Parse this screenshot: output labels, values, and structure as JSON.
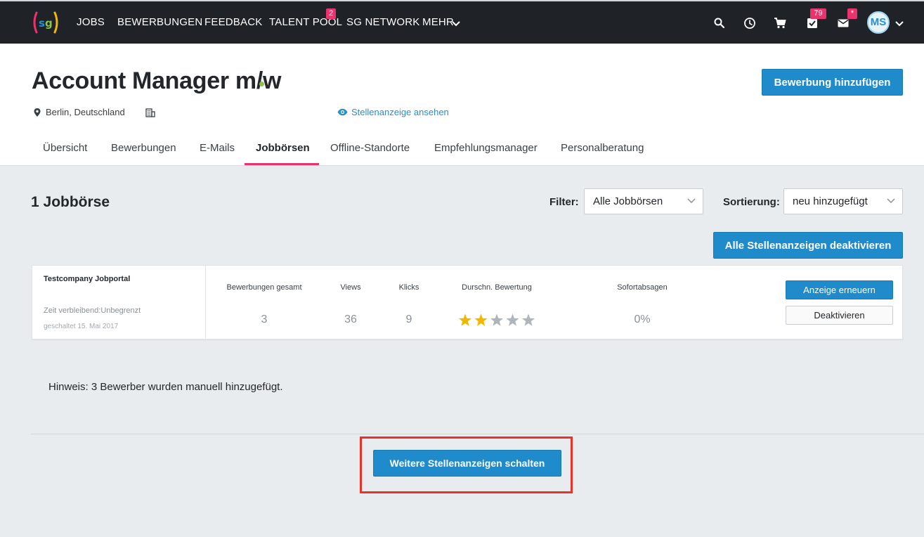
{
  "nav": {
    "items": [
      {
        "label": "JOBS"
      },
      {
        "label": "BEWERBUNGEN"
      },
      {
        "label": "FEEDBACK"
      },
      {
        "label": "TALENT POOL",
        "badge": "2"
      },
      {
        "label": "SG NETWORK"
      },
      {
        "label": "MEHR"
      }
    ],
    "tasks_badge": "79",
    "mail_badge": "*",
    "avatar_initials": "MS"
  },
  "header": {
    "title": "Account Manager m/w",
    "location": "Berlin, Deutschland",
    "view_link": "Stellenanzeige ansehen",
    "add_button": "Bewerbung hinzufügen",
    "tabs": [
      "Übersicht",
      "Bewerbungen",
      "E-Mails",
      "Jobbörsen",
      "Offline-Standorte",
      "Empfehlungsmanager",
      "Personalberatung"
    ],
    "active_tab": "Jobbörsen"
  },
  "main": {
    "count_title": "1 Jobbörse",
    "filter_label": "Filter:",
    "filter_value": "Alle Jobbörsen",
    "sort_label": "Sortierung:",
    "sort_value": "neu hinzugefügt",
    "deactivate_all": "Alle Stellenanzeigen deaktivieren",
    "card": {
      "portal": "Testcompany Jobportal",
      "remaining": "Zeit verbleibend:Unbegrenzt",
      "since": "geschaltet 15. Mai 2017",
      "stats": [
        {
          "header": "Bewerbungen gesamt",
          "value": "3"
        },
        {
          "header": "Views",
          "value": "36"
        },
        {
          "header": "Klicks",
          "value": "9"
        },
        {
          "header": "Durschn. Bewertung",
          "value": ""
        },
        {
          "header": "Sofortabsagen",
          "value": "0%"
        }
      ],
      "rating": 2,
      "rating_max": 5,
      "renew_button": "Anzeige erneuern",
      "deactivate_button": "Deaktivieren"
    },
    "hint": "Hinweis: 3 Bewerber wurden manuell hinzugefügt.",
    "more_button": "Weitere Stellenanzeigen schalten"
  },
  "colors": {
    "nav_bg": "#1f2328",
    "primary": "#1f8bcb",
    "accent": "#e8336d",
    "status_dot": "#8cc04b",
    "star_filled": "#f2b700",
    "star_empty": "#b0b5bb",
    "highlight": "#e8322a"
  }
}
